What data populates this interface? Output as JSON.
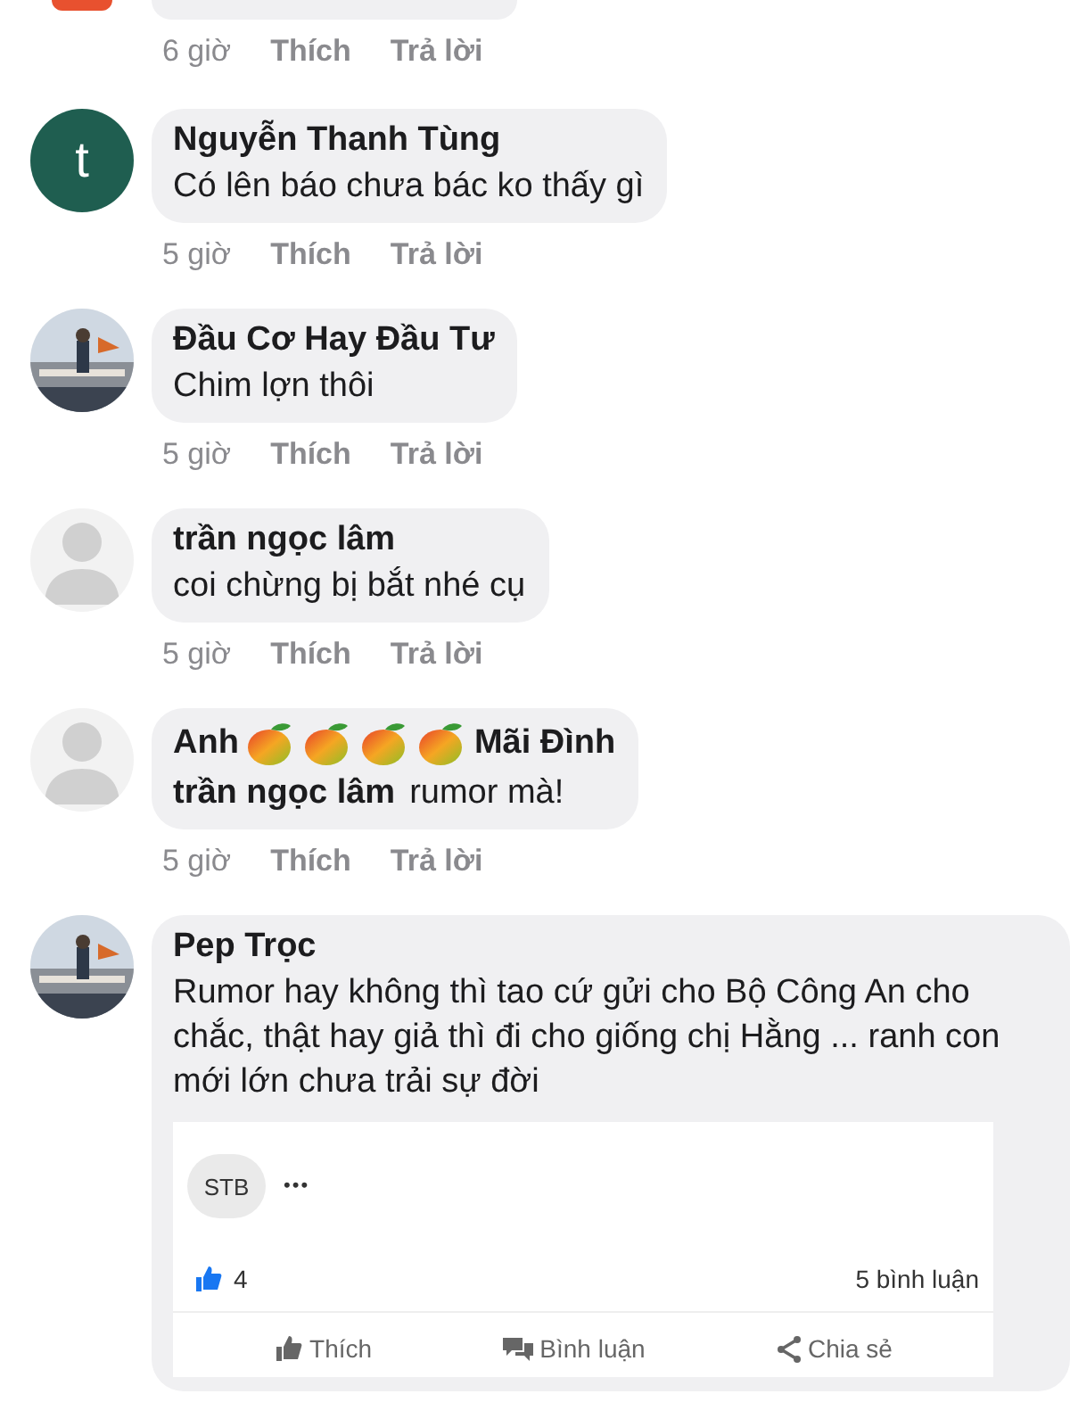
{
  "comments": [
    {
      "kind": "cut",
      "avatar": {
        "kind": "photo_partial"
      },
      "time": "6 giờ",
      "like": "Thích",
      "reply": "Trả lời"
    },
    {
      "kind": "text",
      "avatar": {
        "kind": "letter",
        "letter": "t",
        "color": "#1f5e50"
      },
      "name": [
        {
          "kind": "text",
          "text": "Nguyễn Thanh Tùng"
        }
      ],
      "body": "Có lên báo chưa bác ko thấy gì",
      "time": "5 giờ",
      "like": "Thích",
      "reply": "Trả lời"
    },
    {
      "kind": "text",
      "name": [
        {
          "kind": "text",
          "text": "Đầu Cơ Hay Đầu Tư"
        }
      ],
      "body": "Chim lợn thôi",
      "time": "5 giờ",
      "like": "Thích",
      "reply": "Trả lời"
    },
    {
      "kind": "text",
      "avatar": {
        "kind": "default"
      },
      "name": [
        {
          "kind": "text",
          "text": "trần ngọc lâm"
        }
      ],
      "body": "coi chừng bị bắt nhé cụ",
      "time": "5 giờ",
      "like": "Thích",
      "reply": "Trả lời"
    },
    {
      "kind": "text",
      "avatar": {
        "kind": "default"
      },
      "name": [
        {
          "kind": "text",
          "text": "Anh"
        },
        {
          "kind": "mango"
        },
        {
          "kind": "mango"
        },
        {
          "kind": "mango"
        },
        {
          "kind": "mango"
        },
        {
          "kind": "text",
          "text": "Mãi Đình"
        }
      ],
      "reply_to": "trần ngọc lâm",
      "body": "rumor mà!",
      "time": "5 giờ",
      "like": "Thích",
      "reply": "Trả lời"
    },
    {
      "kind": "shared",
      "name": [
        {
          "kind": "text",
          "text": "Pep Trọc"
        }
      ],
      "body": "Rumor hay không thì tao cứ gửi cho Bộ Công An cho chắc, thật hay giả thì đi cho giống chị Hằng ... ranh con mới lớn chưa trải sự đời",
      "card": {
        "source": "STB",
        "more": "•••",
        "likes": "4",
        "comments": "5 bình luận",
        "actions": [
          {
            "kind": "like",
            "label": "Thích"
          },
          {
            "kind": "comment",
            "label": "Bình luận"
          },
          {
            "kind": "share",
            "label": "Chia sẻ"
          }
        ]
      }
    }
  ]
}
